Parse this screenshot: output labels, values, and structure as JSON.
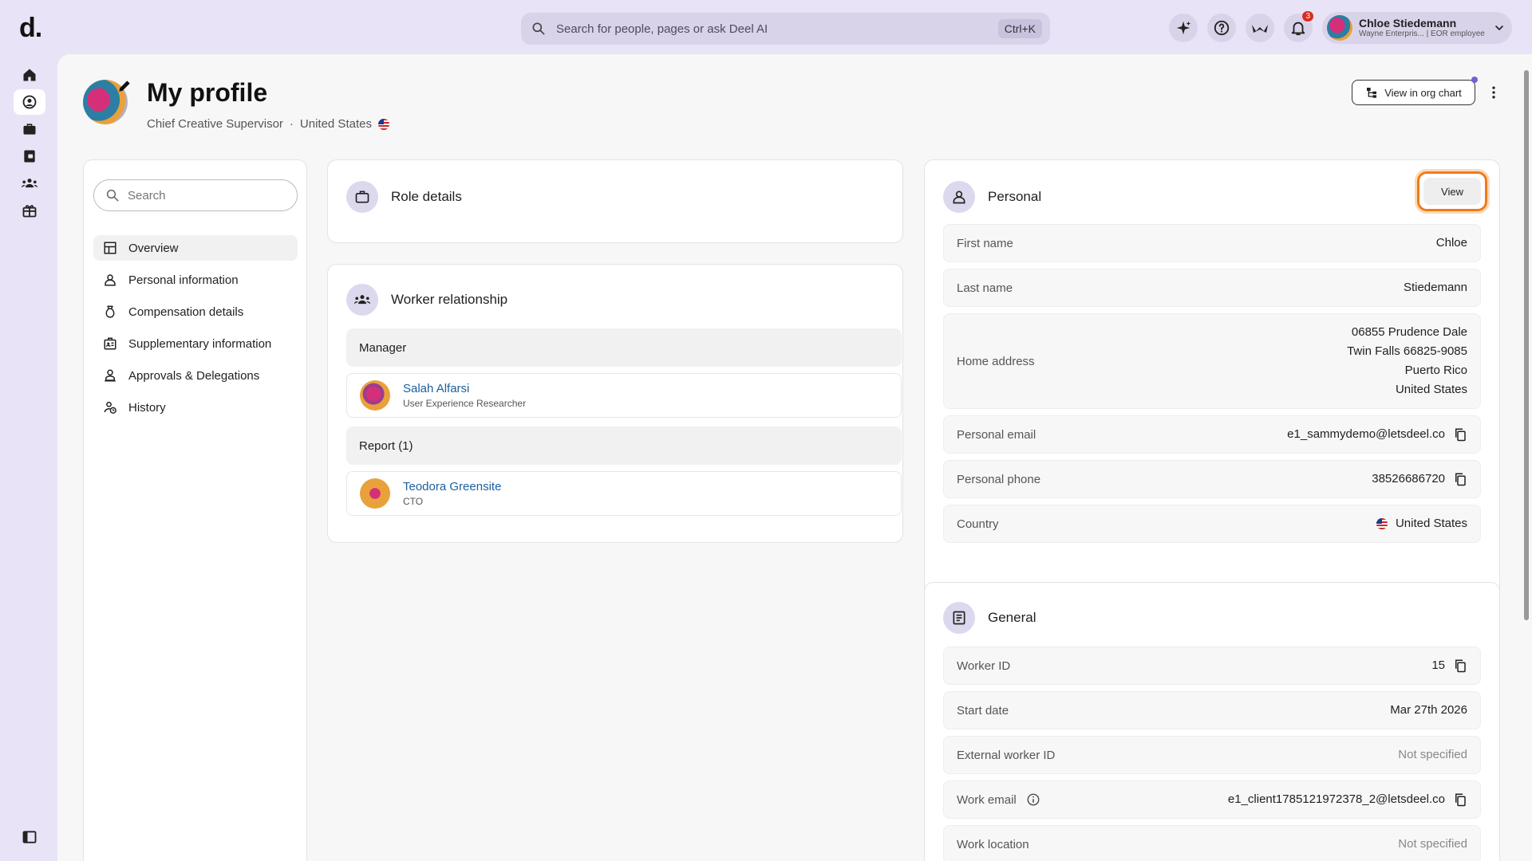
{
  "app": {
    "logo": "d."
  },
  "search": {
    "placeholder": "Search for people, pages or ask Deel AI",
    "shortcut": "Ctrl+K"
  },
  "notifications": {
    "count": "3"
  },
  "user": {
    "name": "Chloe Stiedemann",
    "subtitle": "Wayne Enterpris... | EOR employee"
  },
  "profile": {
    "title": "My profile",
    "job_title": "Chief Creative Supervisor",
    "separator": "·",
    "country": "United States",
    "org_chart_label": "View in org chart"
  },
  "sidebar": {
    "search_placeholder": "Search",
    "items": [
      {
        "label": "Overview",
        "icon": "layout-icon",
        "active": true
      },
      {
        "label": "Personal information",
        "icon": "person-icon"
      },
      {
        "label": "Compensation details",
        "icon": "money-bag-icon"
      },
      {
        "label": "Supplementary information",
        "icon": "id-card-icon"
      },
      {
        "label": "Approvals & Delegations",
        "icon": "person-stamp-icon"
      },
      {
        "label": "History",
        "icon": "person-clock-icon"
      }
    ]
  },
  "role_details": {
    "title": "Role details"
  },
  "worker_relationship": {
    "title": "Worker relationship",
    "manager_header": "Manager",
    "manager": {
      "name": "Salah Alfarsi",
      "title": "User Experience Researcher"
    },
    "reports_header": "Report (1)",
    "report": {
      "name": "Teodora Greensite",
      "title": "CTO"
    }
  },
  "personal": {
    "title": "Personal",
    "view_label": "View",
    "fields": {
      "first_name": {
        "label": "First name",
        "value": "Chloe"
      },
      "last_name": {
        "label": "Last name",
        "value": "Stiedemann"
      },
      "home_address": {
        "label": "Home address",
        "lines": [
          "06855 Prudence Dale",
          "Twin Falls 66825-9085",
          "Puerto Rico",
          "United States"
        ]
      },
      "personal_email": {
        "label": "Personal email",
        "value": "e1_sammydemo@letsdeel.co"
      },
      "personal_phone": {
        "label": "Personal phone",
        "value": "38526686720"
      },
      "country": {
        "label": "Country",
        "value": "United States"
      }
    }
  },
  "general": {
    "title": "General",
    "fields": {
      "worker_id": {
        "label": "Worker ID",
        "value": "15"
      },
      "start_date": {
        "label": "Start date",
        "value": "Mar 27th 2026"
      },
      "external_worker_id": {
        "label": "External worker ID",
        "value": "Not specified"
      },
      "work_email": {
        "label": "Work email",
        "value": "e1_client1785121972378_2@letsdeel.co"
      },
      "work_location": {
        "label": "Work location",
        "value": "Not specified"
      }
    }
  },
  "colors": {
    "accent_purple": "#e8e3f6",
    "link_blue": "#1d5f9e",
    "focus_orange": "#ef7b1a",
    "badge_red": "#d92d20"
  }
}
